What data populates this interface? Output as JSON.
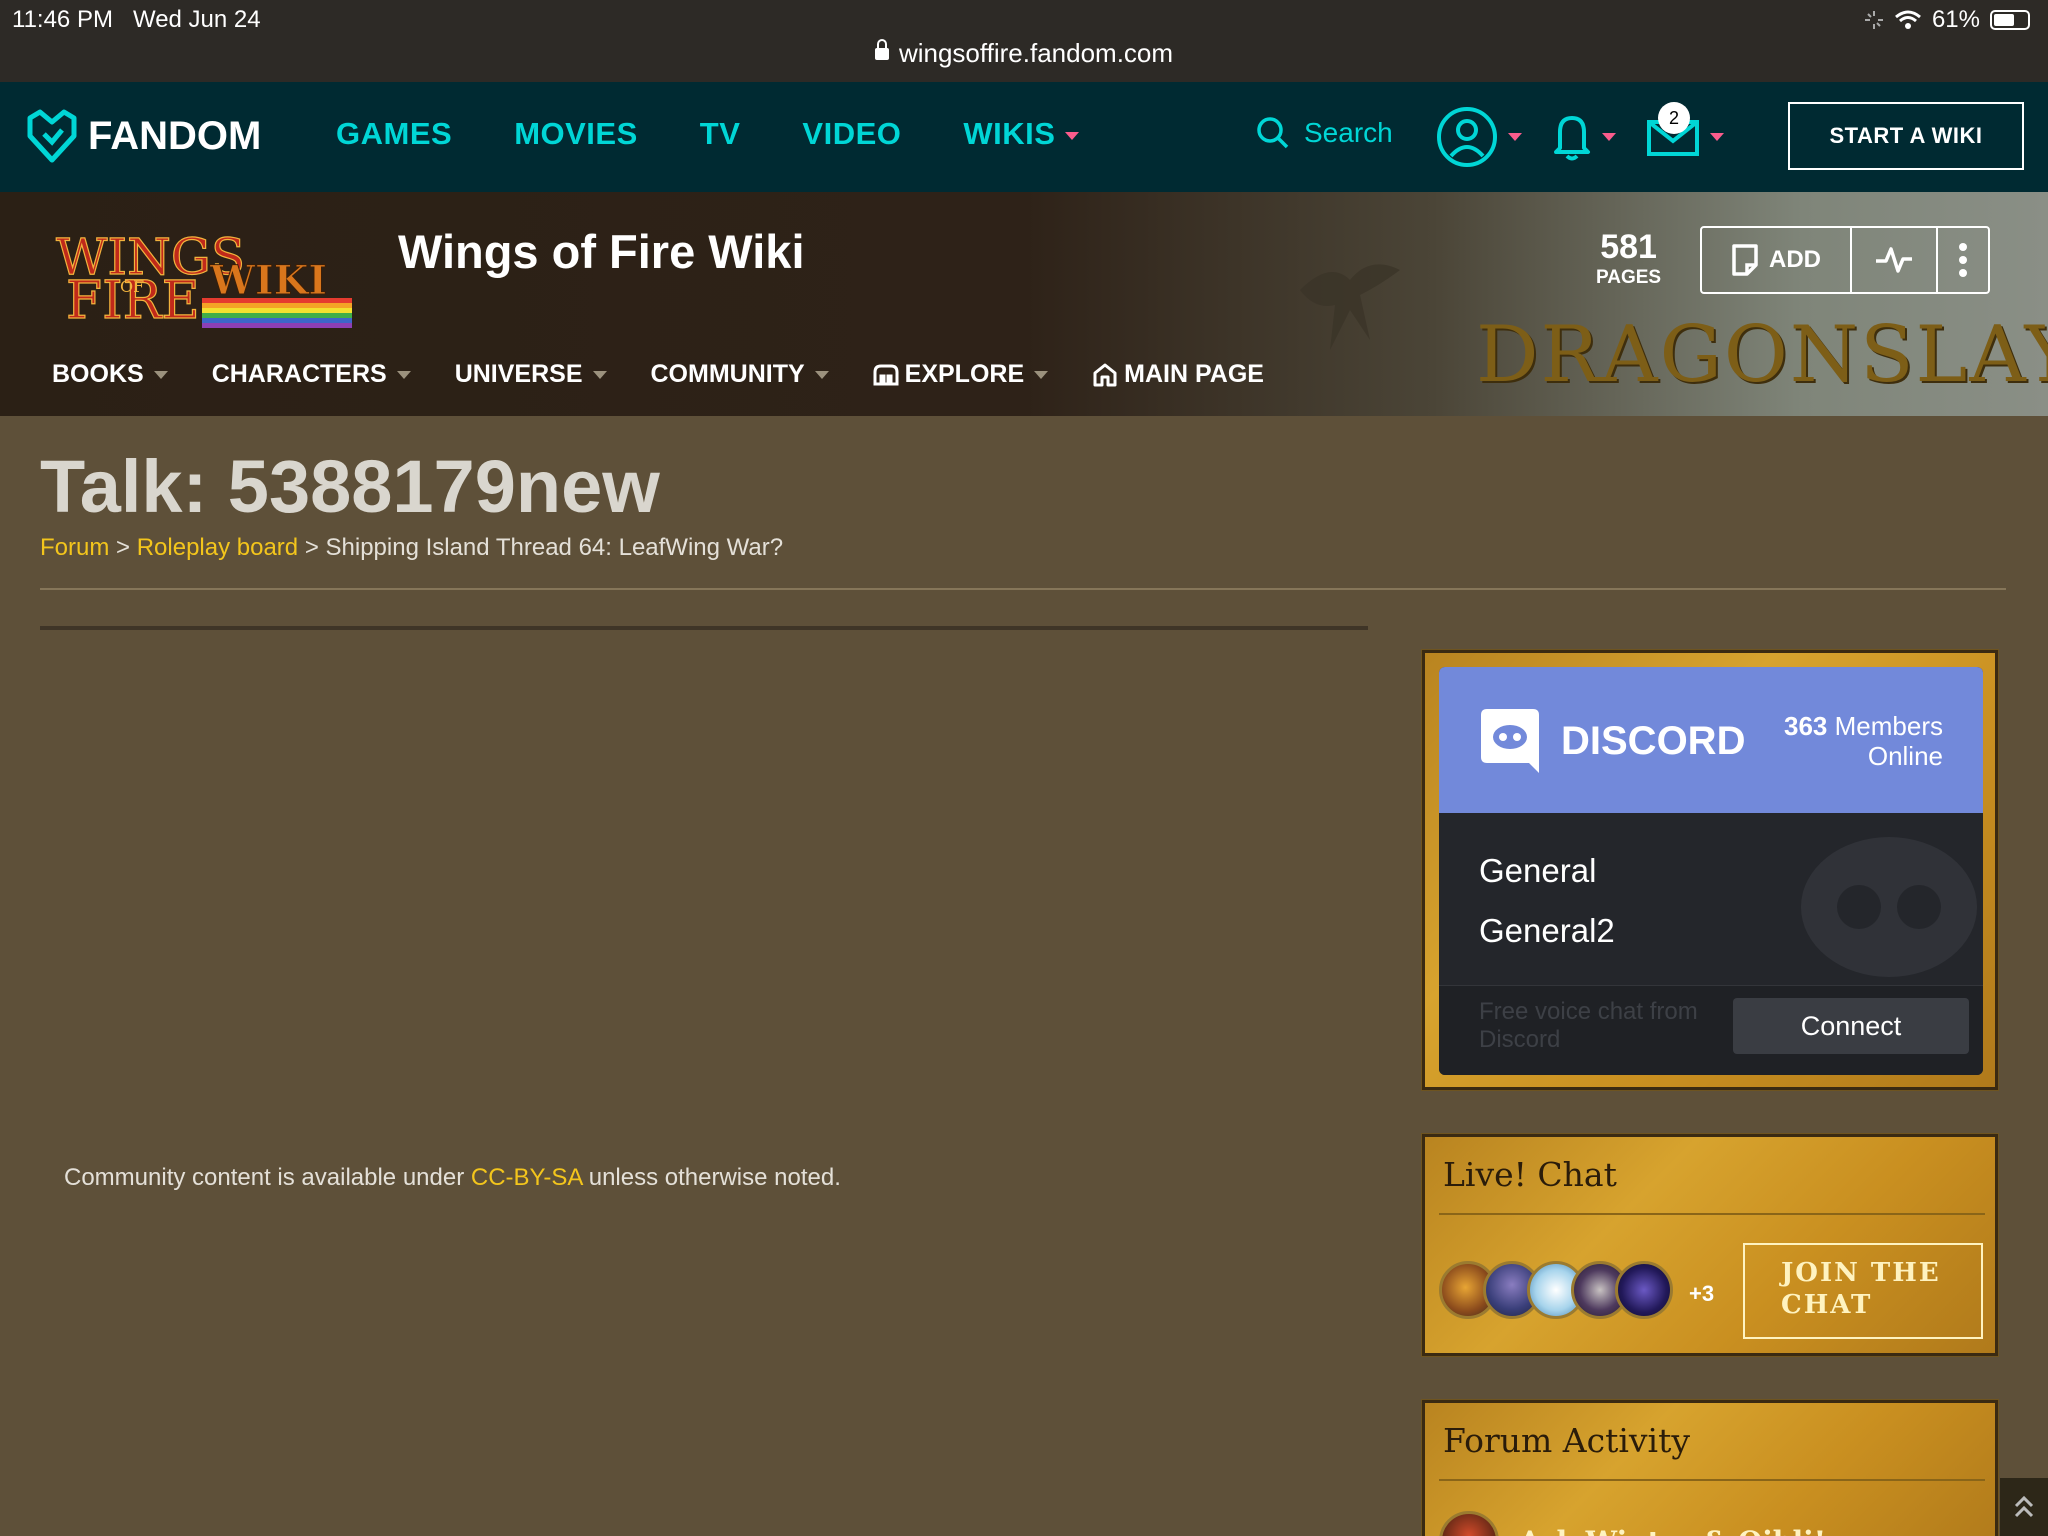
{
  "status_bar": {
    "time": "11:46 PM",
    "date": "Wed Jun 24",
    "battery_percent": 61,
    "battery_label": "61%",
    "url": "wingsoffire.fandom.com"
  },
  "fandom": {
    "brand": "FANDOM",
    "nav": [
      "GAMES",
      "MOVIES",
      "TV",
      "VIDEO",
      "WIKIS"
    ],
    "search_placeholder": "Search",
    "message_count": "2",
    "start_wiki": "START A WIKI",
    "accent_color": "#00d6d6",
    "caret_color": "#fa5c8c"
  },
  "wiki": {
    "title": "Wings of Fire Wiki",
    "logo_text": "WINGS OF FIRE WIKI",
    "banner_text": "DRAGONSLAYER",
    "pages_count": "581",
    "pages_label": "PAGES",
    "add_label": "ADD",
    "nav": [
      "BOOKS",
      "CHARACTERS",
      "UNIVERSE",
      "COMMUNITY",
      "EXPLORE",
      "MAIN PAGE"
    ]
  },
  "page": {
    "title": "Talk: 5388179new",
    "breadcrumb": {
      "forum": "Forum",
      "sep1": ">",
      "board": "Roleplay board",
      "sep2": ">",
      "thread": "Shipping Island Thread 64: LeafWing War?"
    },
    "license_pre": "Community content is available under",
    "license_link": "CC-BY-SA",
    "license_post": "unless otherwise noted."
  },
  "discord": {
    "brand": "DISCORD",
    "members_count": "363",
    "members_label": "Members",
    "online_label": "Online",
    "channels": [
      "General",
      "General2"
    ],
    "footer_text": "Free voice chat from Discord",
    "connect_label": "Connect",
    "color": "#7289da"
  },
  "live_chat": {
    "title": "Live! Chat",
    "more_users": "+3",
    "join_line1": "JOIN THE",
    "join_line2": "CHAT"
  },
  "forum_activity": {
    "title": "Forum Activity",
    "item": "Ask Winter & Qibli!"
  }
}
